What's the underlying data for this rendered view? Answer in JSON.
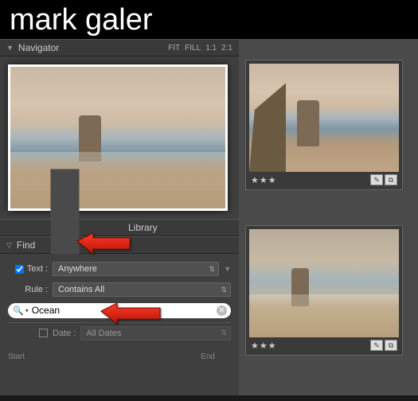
{
  "header": {
    "title_a": "mark",
    "title_b": " galer"
  },
  "navigator": {
    "title": "Navigator",
    "zoom": {
      "fit": "FIT",
      "fill": "FILL",
      "one": "1:1",
      "two": "2:1"
    }
  },
  "library": {
    "title": "Library"
  },
  "find": {
    "title": "Find",
    "text_label": "Text :",
    "text_anywhere": "Anywhere",
    "rule_label": "Rule :",
    "rule_contains": "Contains All",
    "search_value": "Ocean",
    "date_label": "Date :",
    "date_all": "All Dates",
    "start_label": "Start",
    "end_label": "End"
  },
  "thumbs": {
    "stars": "★★★"
  }
}
